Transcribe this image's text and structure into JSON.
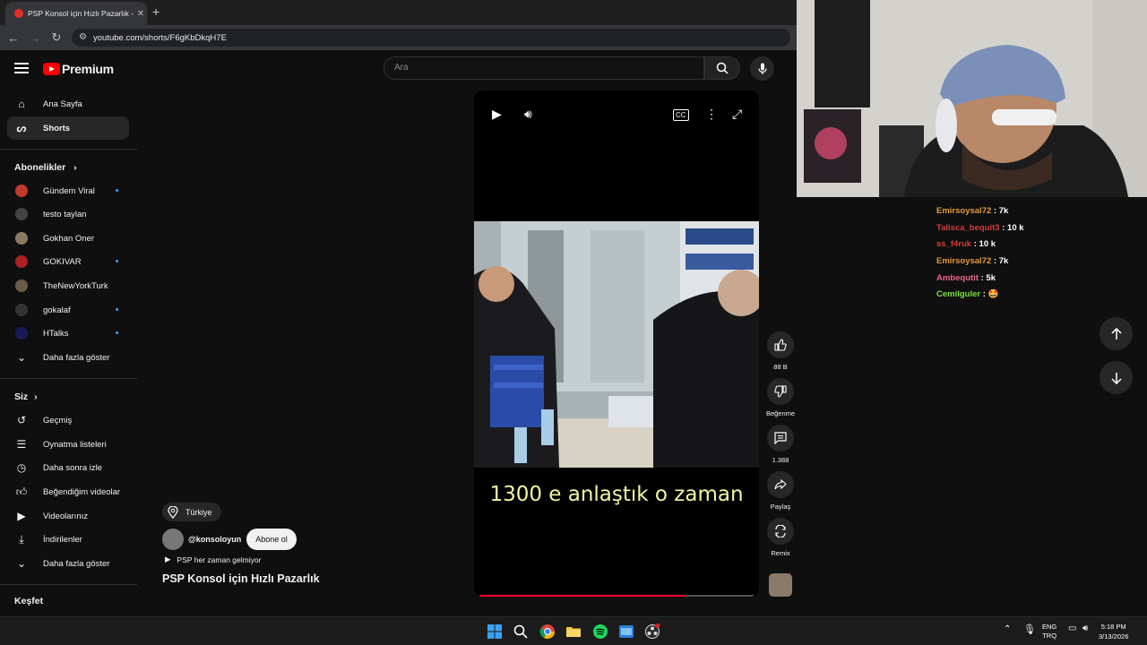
{
  "browser": {
    "tab_title": "PSP Konsol için Hızlı Pazarlık - Y",
    "url": "youtube.com/shorts/F6gKbDkqH7E"
  },
  "header": {
    "logo_text": "Premium",
    "search_placeholder": "Ara"
  },
  "sidebar": {
    "main": [
      {
        "label": "Ana Sayfa",
        "icon": "home-icon"
      },
      {
        "label": "Shorts",
        "icon": "shorts-icon",
        "active": true
      }
    ],
    "subscriptions_header": "Abonelikler",
    "subscriptions": [
      {
        "label": "Gündem Viral",
        "color": "#c0392b",
        "new": true
      },
      {
        "label": "testo taylan",
        "color": "#444444",
        "new": false
      },
      {
        "label": "Gokhan Oner",
        "color": "#8a7a60",
        "new": false
      },
      {
        "label": "GOKIVAR",
        "color": "#aa2222",
        "new": true
      },
      {
        "label": "TheNewYorkTurk",
        "color": "#6a5a4a",
        "new": false
      },
      {
        "label": "gokalaf",
        "color": "#333333",
        "new": true
      },
      {
        "label": "HTalks",
        "color": "#1a1a5a",
        "new": true
      }
    ],
    "show_more_1": "Daha fazla göster",
    "you_header": "Siz",
    "you_items": [
      {
        "label": "Geçmiş",
        "icon": "history-icon"
      },
      {
        "label": "Oynatma listeleri",
        "icon": "playlists-icon"
      },
      {
        "label": "Daha sonra izle",
        "icon": "watch-later-icon"
      },
      {
        "label": "Beğendiğim videolar",
        "icon": "liked-icon"
      },
      {
        "label": "Videolarınız",
        "icon": "your-videos-icon"
      },
      {
        "label": "İndirilenler",
        "icon": "downloads-icon"
      }
    ],
    "show_more_2": "Daha fazla göster",
    "explore_header": "Keşfet"
  },
  "short": {
    "caption": "1300 e anlaştık o zaman",
    "progress": 0.75,
    "location": "Türkiye",
    "channel": "@konsoloyun",
    "subscribe_label": "Abone ol",
    "music": "PSP her zaman gelmiyor",
    "title": "PSP Konsol için Hızlı Pazarlık"
  },
  "actions": {
    "like_count": "88 B",
    "dislike_label": "Beğenme",
    "comment_count": "1.388",
    "share_label": "Paylaş",
    "remix_label": "Remix"
  },
  "chat": [
    {
      "user": "Emirsoysal72",
      "msg": "7k",
      "color": "#e59a3a"
    },
    {
      "user": "Talisca_bequit3",
      "msg": "10 k",
      "color": "#d43b3b"
    },
    {
      "user": "ss_f4ruk",
      "msg": "10 k",
      "color": "#d43b3b"
    },
    {
      "user": "Emirsoysal72",
      "msg": "7k",
      "color": "#e59a3a"
    },
    {
      "user": "Ambequtit",
      "msg": "5k",
      "color": "#e86a8a"
    },
    {
      "user": "Cemilguler",
      "msg": "🤩",
      "color": "#7de03a"
    }
  ],
  "taskbar": {
    "lang_top": "ENG",
    "lang_bottom": "TRQ",
    "time": "5:18 PM",
    "date": "3/13/2026"
  }
}
